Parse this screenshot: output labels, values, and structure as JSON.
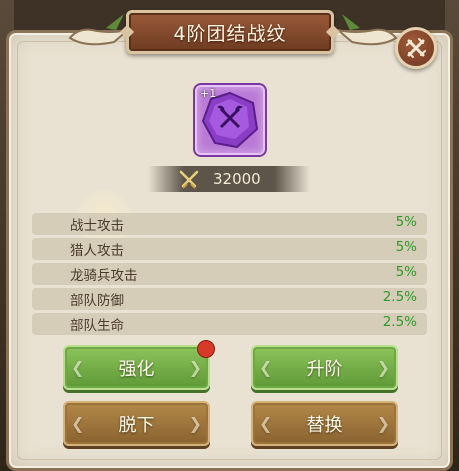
{
  "dialog": {
    "title": "4阶团结战纹"
  },
  "item": {
    "level_badge": "+1",
    "icon": "purple-axe-gem-icon",
    "frame_color": "#b97ad6"
  },
  "power": {
    "icon": "crossed-swords-icon",
    "value": "32000"
  },
  "attributes": [
    {
      "name": "战士攻击",
      "value": "5%"
    },
    {
      "name": "猎人攻击",
      "value": "5%"
    },
    {
      "name": "龙骑兵攻击",
      "value": "5%"
    },
    {
      "name": "部队防御",
      "value": "2.5%"
    },
    {
      "name": "部队生命",
      "value": "2.5%"
    }
  ],
  "buttons": {
    "enhance": "强化",
    "advance": "升阶",
    "remove": "脱下",
    "replace": "替换"
  },
  "colors": {
    "value_green": "#2e9a2a",
    "green_button": "#6ea944",
    "brown_button": "#9c7439",
    "notification": "#d83a2a"
  }
}
